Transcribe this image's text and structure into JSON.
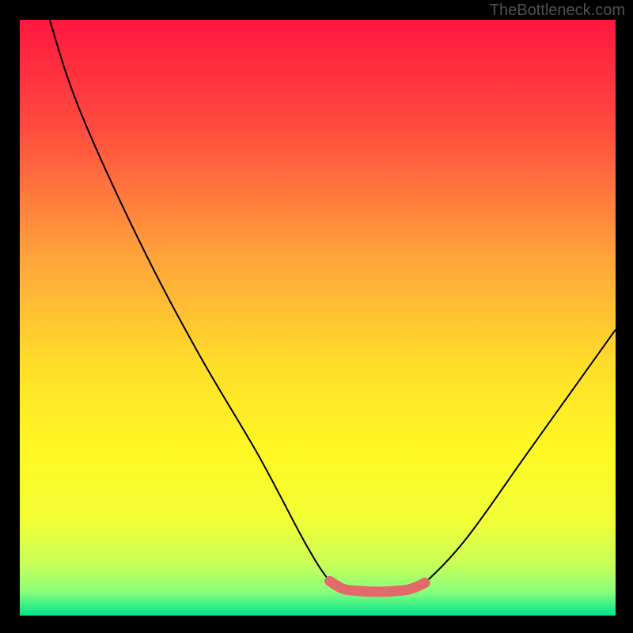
{
  "watermark": "TheBottleneck.com",
  "chart_data": {
    "type": "line",
    "title": "",
    "xlabel": "",
    "ylabel": "",
    "xlim": [
      0,
      100
    ],
    "ylim": [
      0,
      100
    ],
    "gradient_stops": [
      {
        "offset": 0.0,
        "color": "#ff173e"
      },
      {
        "offset": 0.18,
        "color": "#ff4b3f"
      },
      {
        "offset": 0.4,
        "color": "#ffa43b"
      },
      {
        "offset": 0.58,
        "color": "#ffde29"
      },
      {
        "offset": 0.72,
        "color": "#fff824"
      },
      {
        "offset": 0.84,
        "color": "#f2ff36"
      },
      {
        "offset": 0.915,
        "color": "#c7ff59"
      },
      {
        "offset": 0.96,
        "color": "#88ff7c"
      },
      {
        "offset": 1.0,
        "color": "#00e48b"
      }
    ],
    "series": [
      {
        "name": "bottleneck-curve",
        "type": "thin-black",
        "points": [
          {
            "x": 5,
            "y": 100
          },
          {
            "x": 10,
            "y": 85
          },
          {
            "x": 20,
            "y": 63
          },
          {
            "x": 30,
            "y": 44
          },
          {
            "x": 40,
            "y": 27
          },
          {
            "x": 48,
            "y": 12
          },
          {
            "x": 52,
            "y": 5.8
          },
          {
            "x": 54,
            "y": 4.6
          },
          {
            "x": 56,
            "y": 4.2
          },
          {
            "x": 60,
            "y": 4.0
          },
          {
            "x": 64,
            "y": 4.2
          },
          {
            "x": 66,
            "y": 4.6
          },
          {
            "x": 68,
            "y": 5.5
          },
          {
            "x": 75,
            "y": 13
          },
          {
            "x": 85,
            "y": 27
          },
          {
            "x": 95,
            "y": 41
          },
          {
            "x": 100,
            "y": 48
          }
        ]
      },
      {
        "name": "optimal-zone",
        "type": "thick-salmon",
        "color": "#e26a6b",
        "points": [
          {
            "x": 52,
            "y": 5.8
          },
          {
            "x": 54,
            "y": 4.6
          },
          {
            "x": 56,
            "y": 4.2
          },
          {
            "x": 60,
            "y": 4.0
          },
          {
            "x": 64,
            "y": 4.2
          },
          {
            "x": 66,
            "y": 4.6
          },
          {
            "x": 68,
            "y": 5.5
          }
        ]
      }
    ]
  }
}
